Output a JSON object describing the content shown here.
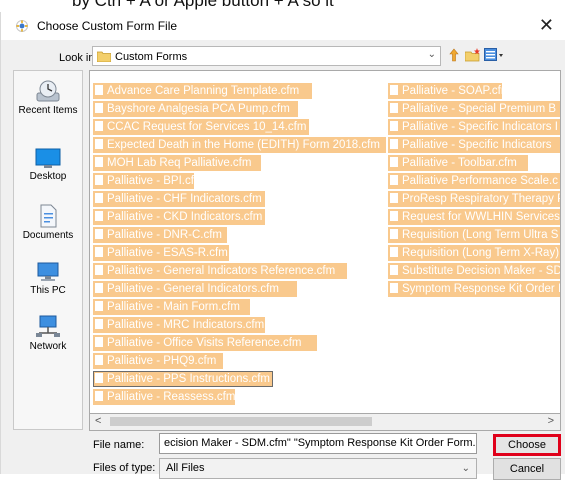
{
  "caption": "by Ctrl + A  or Apple button + A  so it",
  "dialog": {
    "title": "Choose Custom Form File",
    "look_in_label": "Look in:",
    "look_in_value": "Custom Forms"
  },
  "places": [
    {
      "label": "Recent Items",
      "icon": "recent-items-icon"
    },
    {
      "label": "Desktop",
      "icon": "desktop-icon"
    },
    {
      "label": "Documents",
      "icon": "documents-icon"
    },
    {
      "label": "This PC",
      "icon": "this-pc-icon"
    },
    {
      "label": "Network",
      "icon": "network-icon"
    }
  ],
  "files": {
    "left": [
      "Advance Care Planning Template.cfm",
      "Bayshore Analgesia PCA Pump.cfm",
      "CCAC Request for Services 10_14.cfm",
      "Expected Death in the Home (EDITH) Form 2018.cfm",
      "MOH Lab Req Palliative.cfm",
      "Palliative - BPI.cfm",
      "Palliative - CHF Indicators.cfm",
      "Palliative - CKD Indicators.cfm",
      "Palliative - DNR-C.cfm",
      "Palliative - ESAS-R.cfm",
      "Palliative - General Indicators Reference.cfm",
      "Palliative - General Indicators.cfm",
      "Palliative - Main Form.cfm",
      "Palliative - MRC Indicators.cfm",
      "Palliative - Office Visits Reference.cfm",
      "Palliative - PHQ9.cfm",
      "Palliative - PPS Instructions.cfm",
      "Palliative - Reassess.cfm"
    ],
    "right": [
      "Palliative - SOAP.cfm",
      "Palliative - Special Premium B",
      "Palliative - Specific Indicators I",
      "Palliative - Specific Indicators",
      "Palliative - Toolbar.cfm",
      "Palliative Performance Scale.c",
      "ProResp Respiratory Therapy P",
      "Request for WWLHIN Services.",
      "Requisition (Long Term Ultra S",
      "Requisition (Long Term X-Ray)",
      "Substitute Decision Maker - SD",
      "Symptom Response Kit Order I"
    ]
  },
  "footer": {
    "file_name_label": "File name:",
    "file_name_value": "ecision Maker - SDM.cfm\" \"Symptom Response Kit Order Form.cfm\"",
    "file_type_label": "Files of type:",
    "file_type_value": "All Files",
    "choose_label": "Choose",
    "cancel_label": "Cancel"
  },
  "colors": {
    "selection": "#f9c98d",
    "highlight_border": "#e0001a"
  }
}
